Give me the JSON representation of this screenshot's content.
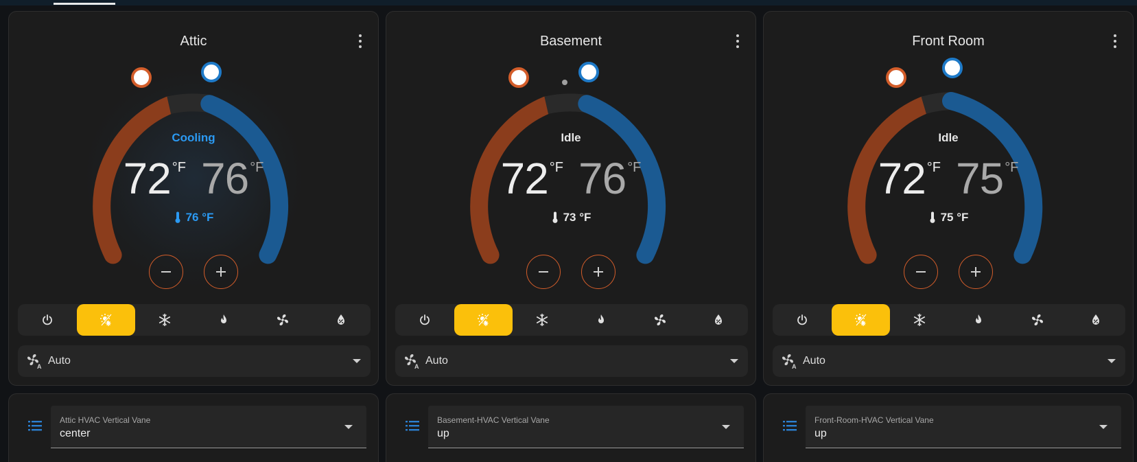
{
  "colors": {
    "heat": "#d35d2a",
    "cool": "#1e7ac8",
    "active_mode": "#fbc00b",
    "cooling_text": "#2b9af3"
  },
  "modes": [
    {
      "name": "off",
      "icon": "power-icon"
    },
    {
      "name": "heat_cool",
      "icon": "sun-snowflake-icon"
    },
    {
      "name": "cool",
      "icon": "snowflake-icon"
    },
    {
      "name": "heat",
      "icon": "fire-icon"
    },
    {
      "name": "fan_only",
      "icon": "fan-icon"
    },
    {
      "name": "dry",
      "icon": "water-percent-icon"
    }
  ],
  "thermostats": [
    {
      "title": "Attic",
      "action": "Cooling",
      "low": "72",
      "high": "76",
      "unit": "°F",
      "current": "76 °F",
      "active_mode": "heat_cool",
      "fan_mode": "Auto",
      "vane_label": "Attic HVAC Vertical Vane",
      "vane_value": "center"
    },
    {
      "title": "Basement",
      "action": "Idle",
      "low": "72",
      "high": "76",
      "unit": "°F",
      "current": "73 °F",
      "active_mode": "heat_cool",
      "fan_mode": "Auto",
      "vane_label": "Basement-HVAC Vertical Vane",
      "vane_value": "up"
    },
    {
      "title": "Front Room",
      "action": "Idle",
      "low": "72",
      "high": "75",
      "unit": "°F",
      "current": "75 °F",
      "active_mode": "heat_cool",
      "fan_mode": "Auto",
      "vane_label": "Front-Room-HVAC Vertical Vane",
      "vane_value": "up"
    }
  ]
}
